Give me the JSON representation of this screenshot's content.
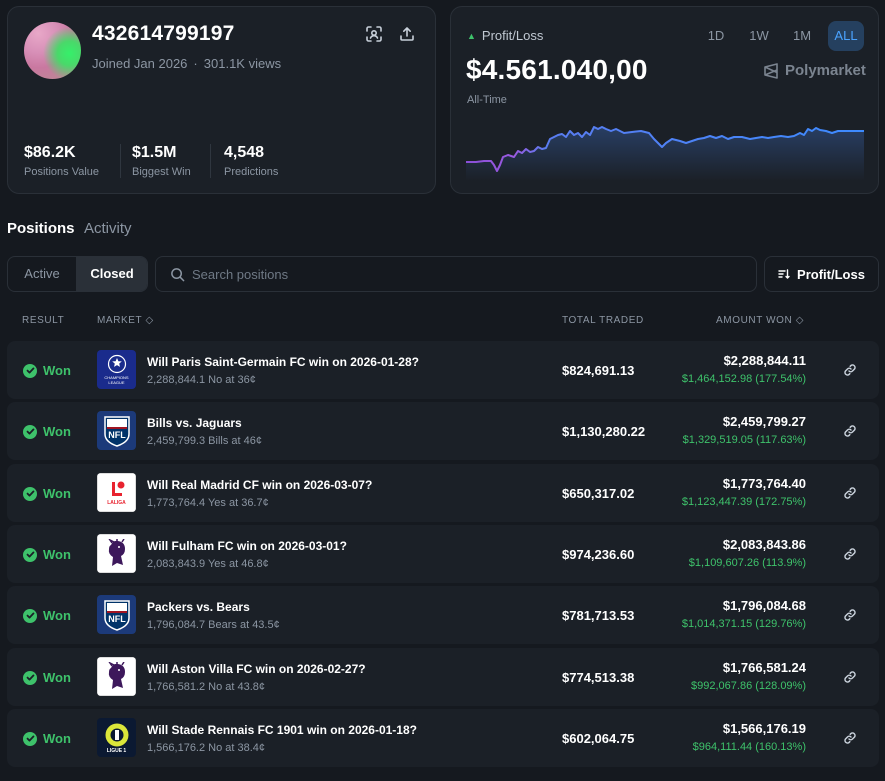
{
  "profile": {
    "username": "432614799197",
    "joined": "Joined Jan 2026",
    "views": "301.1K views",
    "stats": [
      {
        "value": "$86.2K",
        "label": "Positions Value"
      },
      {
        "value": "$1.5M",
        "label": "Biggest Win"
      },
      {
        "value": "4,548",
        "label": "Predictions"
      }
    ]
  },
  "pnl": {
    "label": "Profit/Loss",
    "value": "$4.561.040,00",
    "period": "All-Time",
    "ranges": [
      "1D",
      "1W",
      "1M",
      "ALL"
    ],
    "active_range": "ALL",
    "brand": "Polymarket"
  },
  "tabs": {
    "positions": "Positions",
    "activity": "Activity"
  },
  "filter": {
    "active": "Active",
    "closed": "Closed"
  },
  "search": {
    "placeholder": "Search positions"
  },
  "sort": {
    "label": "Profit/Loss"
  },
  "columns": {
    "result": "RESULT",
    "market": "MARKET",
    "total_traded": "TOTAL TRADED",
    "amount_won": "AMOUNT WON"
  },
  "rows": [
    {
      "result": "Won",
      "title": "Will Paris Saint-Germain FC win on 2026-01-28?",
      "sub": "2,288,844.1 No at 36¢",
      "traded": "$824,691.13",
      "amount": "$2,288,844.11",
      "gain": "$1,464,152.98 (177.54%)",
      "logo": "champions-league"
    },
    {
      "result": "Won",
      "title": "Bills vs. Jaguars",
      "sub": "2,459,799.3 Bills at 46¢",
      "traded": "$1,130,280.22",
      "amount": "$2,459,799.27",
      "gain": "$1,329,519.05 (117.63%)",
      "logo": "nfl"
    },
    {
      "result": "Won",
      "title": "Will Real Madrid CF win on 2026-03-07?",
      "sub": "1,773,764.4 Yes at 36.7¢",
      "traded": "$650,317.02",
      "amount": "$1,773,764.40",
      "gain": "$1,123,447.39 (172.75%)",
      "logo": "laliga"
    },
    {
      "result": "Won",
      "title": "Will Fulham FC win on 2026-03-01?",
      "sub": "2,083,843.9 Yes at 46.8¢",
      "traded": "$974,236.60",
      "amount": "$2,083,843.86",
      "gain": "$1,109,607.26 (113.9%)",
      "logo": "premier-league"
    },
    {
      "result": "Won",
      "title": "Packers vs. Bears",
      "sub": "1,796,084.7 Bears at 43.5¢",
      "traded": "$781,713.53",
      "amount": "$1,796,084.68",
      "gain": "$1,014,371.15 (129.76%)",
      "logo": "nfl"
    },
    {
      "result": "Won",
      "title": "Will Aston Villa FC win on 2026-02-27?",
      "sub": "1,766,581.2 No at 43.8¢",
      "traded": "$774,513.38",
      "amount": "$1,766,581.24",
      "gain": "$992,067.86 (128.09%)",
      "logo": "premier-league"
    },
    {
      "result": "Won",
      "title": "Will Stade Rennais FC 1901 win on 2026-01-18?",
      "sub": "1,566,176.2 No at 38.4¢",
      "traded": "$602,064.75",
      "amount": "$1,566,176.19",
      "gain": "$964,111.44 (160.13%)",
      "logo": "ligue1"
    }
  ],
  "logo_text": {
    "champions-league": "CHAMPIONS LEAGUE",
    "nfl": "NFL",
    "laliga": "LALIGA",
    "ligue1": "LIGUE 1"
  },
  "colors": {
    "accent": "#4aa3ff",
    "positive": "#3ec26b",
    "background": "#15191f",
    "card": "#1b2027"
  }
}
